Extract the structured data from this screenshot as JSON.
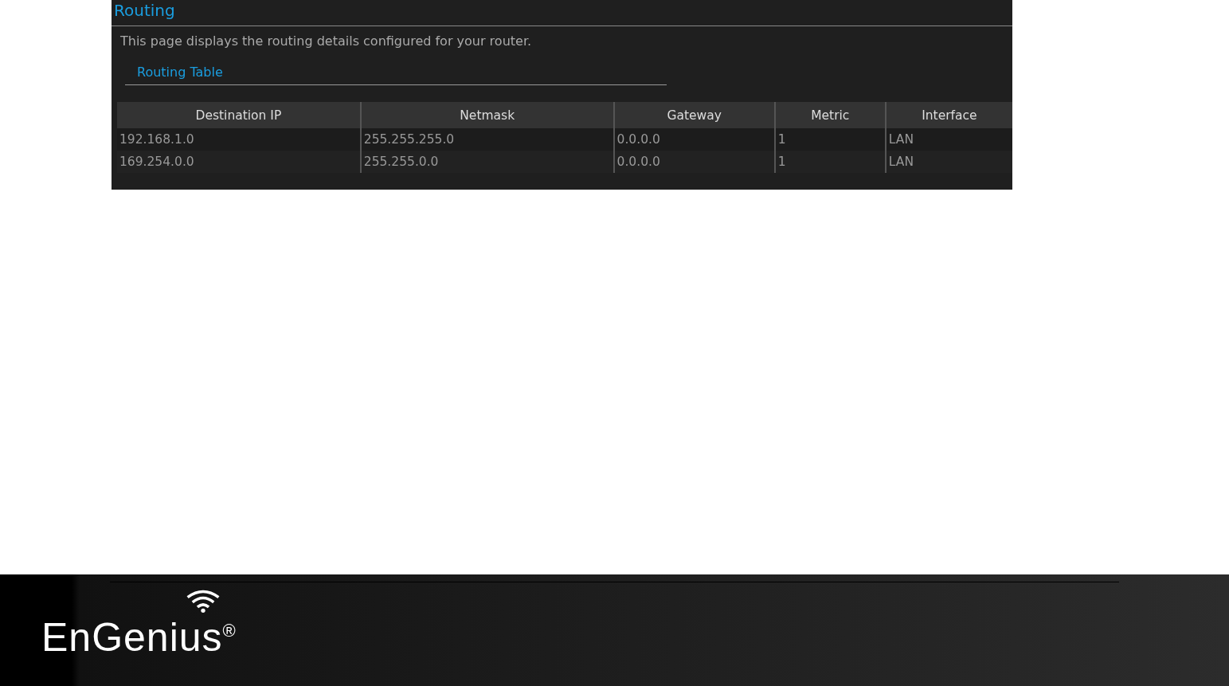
{
  "page": {
    "title": "Routing",
    "description": "This page displays the routing details configured for your router.",
    "section_title": "Routing Table",
    "table": {
      "columns": [
        "Destination IP",
        "Netmask",
        "Gateway",
        "Metric",
        "Interface"
      ],
      "rows": [
        [
          "192.168.1.0",
          "255.255.255.0",
          "0.0.0.0",
          "1",
          "LAN"
        ],
        [
          "169.254.0.0",
          "255.255.0.0",
          "0.0.0.0",
          "1",
          "LAN"
        ]
      ]
    }
  },
  "footer": {
    "logo": "EnGenius$^{®}$"
  }
}
